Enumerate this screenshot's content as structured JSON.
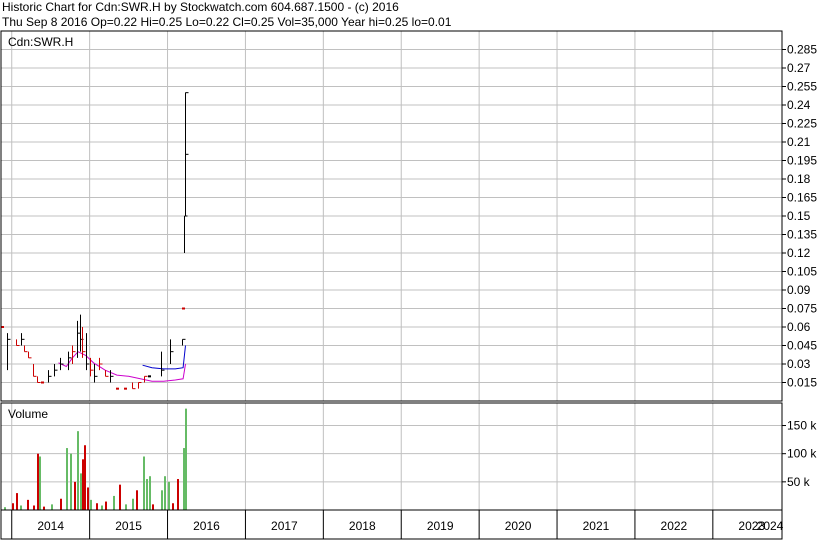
{
  "header": {
    "line1": "Historic Chart for Cdn:SWR.H by Stockwatch.com 604.687.1500 - (c) 2016",
    "line2": "Thu Sep  8 2016  Op=0.22  Hi=0.25  Lo=0.22  Cl=0.25  Vol=35,000  Year hi=0.25  lo=0.01"
  },
  "chart_data": [
    {
      "type": "line",
      "title": "Cdn:SWR.H",
      "ylim": [
        0,
        0.3
      ],
      "yticks": [
        "0.285",
        "0.27",
        "0.255",
        "0.24",
        "0.225",
        "0.21",
        "0.195",
        "0.18",
        "0.165",
        "0.15",
        "0.135",
        "0.12",
        "0.105",
        "0.09",
        "0.075",
        "0.06",
        "0.045",
        "0.03",
        "0.015"
      ],
      "xticks": [
        "2014",
        "2015",
        "2016",
        "2017",
        "2018",
        "2019",
        "2020",
        "2021",
        "2022",
        "2023",
        "2024"
      ],
      "colors": {
        "up": "#000000",
        "down": "#cc0000",
        "ma": "#cc00cc",
        "ma2": "#0000cc",
        "grid": "#c0c0c0"
      },
      "price_bars": [
        {
          "x": 2013.88,
          "h": 0.06,
          "l": 0.06,
          "c": 0.06,
          "dir": "down"
        },
        {
          "x": 2013.94,
          "h": 0.055,
          "l": 0.025,
          "c": 0.05,
          "dir": "up"
        },
        {
          "x": 2014.06,
          "h": 0.05,
          "l": 0.045,
          "c": 0.045,
          "dir": "down"
        },
        {
          "x": 2014.12,
          "h": 0.055,
          "l": 0.045,
          "c": 0.05,
          "dir": "up"
        },
        {
          "x": 2014.16,
          "h": 0.045,
          "l": 0.04,
          "c": 0.04,
          "dir": "down"
        },
        {
          "x": 2014.21,
          "h": 0.04,
          "l": 0.035,
          "c": 0.035,
          "dir": "down"
        },
        {
          "x": 2014.27,
          "h": 0.03,
          "l": 0.02,
          "c": 0.02,
          "dir": "down"
        },
        {
          "x": 2014.33,
          "h": 0.02,
          "l": 0.015,
          "c": 0.015,
          "dir": "down"
        },
        {
          "x": 2014.39,
          "h": 0.015,
          "l": 0.015,
          "c": 0.015,
          "dir": "down"
        },
        {
          "x": 2014.46,
          "h": 0.025,
          "l": 0.015,
          "c": 0.02,
          "dir": "up"
        },
        {
          "x": 2014.54,
          "h": 0.03,
          "l": 0.02,
          "c": 0.025,
          "dir": "up"
        },
        {
          "x": 2014.62,
          "h": 0.035,
          "l": 0.025,
          "c": 0.03,
          "dir": "up"
        },
        {
          "x": 2014.72,
          "h": 0.04,
          "l": 0.025,
          "c": 0.035,
          "dir": "up"
        },
        {
          "x": 2014.78,
          "h": 0.045,
          "l": 0.03,
          "c": 0.04,
          "dir": "down"
        },
        {
          "x": 2014.84,
          "h": 0.065,
          "l": 0.035,
          "c": 0.055,
          "dir": "up"
        },
        {
          "x": 2014.88,
          "h": 0.07,
          "l": 0.04,
          "c": 0.05,
          "dir": "up"
        },
        {
          "x": 2014.9,
          "h": 0.06,
          "l": 0.035,
          "c": 0.04,
          "dir": "down"
        },
        {
          "x": 2014.95,
          "h": 0.055,
          "l": 0.025,
          "c": 0.03,
          "dir": "up"
        },
        {
          "x": 2015.0,
          "h": 0.035,
          "l": 0.02,
          "c": 0.025,
          "dir": "down"
        },
        {
          "x": 2015.05,
          "h": 0.03,
          "l": 0.015,
          "c": 0.02,
          "dir": "up"
        },
        {
          "x": 2015.12,
          "h": 0.035,
          "l": 0.025,
          "c": 0.03,
          "dir": "down"
        },
        {
          "x": 2015.2,
          "h": 0.025,
          "l": 0.02,
          "c": 0.02,
          "dir": "down"
        },
        {
          "x": 2015.26,
          "h": 0.025,
          "l": 0.015,
          "c": 0.02,
          "dir": "up"
        },
        {
          "x": 2015.35,
          "h": 0.01,
          "l": 0.01,
          "c": 0.01,
          "dir": "down"
        },
        {
          "x": 2015.45,
          "h": 0.01,
          "l": 0.01,
          "c": 0.01,
          "dir": "down"
        },
        {
          "x": 2015.55,
          "h": 0.015,
          "l": 0.01,
          "c": 0.01,
          "dir": "down"
        },
        {
          "x": 2015.62,
          "h": 0.015,
          "l": 0.01,
          "c": 0.015,
          "dir": "down"
        },
        {
          "x": 2015.7,
          "h": 0.02,
          "l": 0.015,
          "c": 0.02,
          "dir": "down"
        },
        {
          "x": 2015.76,
          "h": 0.02,
          "l": 0.02,
          "c": 0.02,
          "dir": "up"
        },
        {
          "x": 2015.92,
          "h": 0.04,
          "l": 0.02,
          "c": 0.025,
          "dir": "up"
        },
        {
          "x": 2016.03,
          "h": 0.05,
          "l": 0.03,
          "c": 0.04,
          "dir": "up"
        },
        {
          "x": 2016.18,
          "h": 0.05,
          "l": 0.045,
          "c": 0.05,
          "dir": "up"
        },
        {
          "x": 2016.2,
          "h": 0.075,
          "l": 0.075,
          "c": 0.075,
          "dir": "down"
        },
        {
          "x": 2016.21,
          "h": 0.15,
          "l": 0.12,
          "c": 0.15,
          "dir": "up"
        },
        {
          "x": 2016.22,
          "h": 0.25,
          "l": 0.15,
          "c": 0.2,
          "dir": "up"
        },
        {
          "x": 2016.23,
          "h": 0.25,
          "l": 0.22,
          "c": 0.25,
          "dir": "up"
        }
      ],
      "moving_average": [
        {
          "x": 2014.6,
          "y": 0.031
        },
        {
          "x": 2014.7,
          "y": 0.028
        },
        {
          "x": 2014.78,
          "y": 0.035
        },
        {
          "x": 2014.85,
          "y": 0.04
        },
        {
          "x": 2014.95,
          "y": 0.037
        },
        {
          "x": 2015.05,
          "y": 0.031
        },
        {
          "x": 2015.2,
          "y": 0.025
        },
        {
          "x": 2015.35,
          "y": 0.021
        },
        {
          "x": 2015.5,
          "y": 0.02
        },
        {
          "x": 2015.65,
          "y": 0.018
        },
        {
          "x": 2015.8,
          "y": 0.016
        },
        {
          "x": 2015.95,
          "y": 0.016
        },
        {
          "x": 2016.1,
          "y": 0.017
        },
        {
          "x": 2016.2,
          "y": 0.018
        },
        {
          "x": 2016.23,
          "y": 0.03
        }
      ],
      "moving_average_2": [
        {
          "x": 2015.68,
          "y": 0.029
        },
        {
          "x": 2015.8,
          "y": 0.027
        },
        {
          "x": 2015.95,
          "y": 0.026
        },
        {
          "x": 2016.1,
          "y": 0.026
        },
        {
          "x": 2016.2,
          "y": 0.027
        },
        {
          "x": 2016.23,
          "y": 0.045
        }
      ]
    },
    {
      "type": "bar",
      "title": "Volume",
      "ylim": [
        0,
        190000
      ],
      "yticks": [
        "150 k",
        "100 k",
        "50 k"
      ],
      "bars": [
        {
          "x": 2013.9,
          "v": 5000,
          "dir": "up"
        },
        {
          "x": 2014.0,
          "v": 12000,
          "dir": "down"
        },
        {
          "x": 2014.05,
          "v": 30000,
          "dir": "down"
        },
        {
          "x": 2014.1,
          "v": 8000,
          "dir": "up"
        },
        {
          "x": 2014.2,
          "v": 18000,
          "dir": "down"
        },
        {
          "x": 2014.27,
          "v": 8000,
          "dir": "down"
        },
        {
          "x": 2014.32,
          "v": 100000,
          "dir": "down"
        },
        {
          "x": 2014.35,
          "v": 95000,
          "dir": "up"
        },
        {
          "x": 2014.4,
          "v": 6000,
          "dir": "down"
        },
        {
          "x": 2014.5,
          "v": 10000,
          "dir": "up"
        },
        {
          "x": 2014.62,
          "v": 20000,
          "dir": "down"
        },
        {
          "x": 2014.7,
          "v": 110000,
          "dir": "up"
        },
        {
          "x": 2014.75,
          "v": 100000,
          "dir": "up"
        },
        {
          "x": 2014.8,
          "v": 50000,
          "dir": "down"
        },
        {
          "x": 2014.84,
          "v": 140000,
          "dir": "up"
        },
        {
          "x": 2014.87,
          "v": 65000,
          "dir": "up"
        },
        {
          "x": 2014.9,
          "v": 90000,
          "dir": "down"
        },
        {
          "x": 2014.93,
          "v": 115000,
          "dir": "down"
        },
        {
          "x": 2014.97,
          "v": 40000,
          "dir": "down"
        },
        {
          "x": 2015.0,
          "v": 18000,
          "dir": "up"
        },
        {
          "x": 2015.08,
          "v": 12000,
          "dir": "down"
        },
        {
          "x": 2015.15,
          "v": 8000,
          "dir": "up"
        },
        {
          "x": 2015.2,
          "v": 15000,
          "dir": "down"
        },
        {
          "x": 2015.3,
          "v": 25000,
          "dir": "up"
        },
        {
          "x": 2015.38,
          "v": 45000,
          "dir": "down"
        },
        {
          "x": 2015.45,
          "v": 10000,
          "dir": "up"
        },
        {
          "x": 2015.55,
          "v": 20000,
          "dir": "up"
        },
        {
          "x": 2015.6,
          "v": 35000,
          "dir": "down"
        },
        {
          "x": 2015.68,
          "v": 95000,
          "dir": "up"
        },
        {
          "x": 2015.72,
          "v": 55000,
          "dir": "up"
        },
        {
          "x": 2015.76,
          "v": 60000,
          "dir": "up"
        },
        {
          "x": 2015.8,
          "v": 10000,
          "dir": "down"
        },
        {
          "x": 2015.92,
          "v": 35000,
          "dir": "up"
        },
        {
          "x": 2015.96,
          "v": 60000,
          "dir": "up"
        },
        {
          "x": 2016.0,
          "v": 50000,
          "dir": "up"
        },
        {
          "x": 2016.06,
          "v": 12000,
          "dir": "down"
        },
        {
          "x": 2016.12,
          "v": 55000,
          "dir": "down"
        },
        {
          "x": 2016.2,
          "v": 110000,
          "dir": "up"
        },
        {
          "x": 2016.23,
          "v": 180000,
          "dir": "up"
        }
      ],
      "colors": {
        "up": "#66bb66",
        "down": "#cc0000"
      }
    }
  ]
}
